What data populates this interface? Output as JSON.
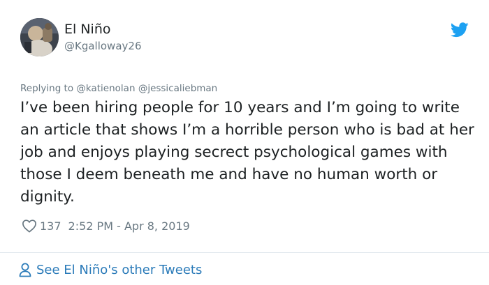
{
  "author": {
    "display_name": "El Niño",
    "handle": "@Kgalloway26"
  },
  "replying": {
    "prefix": "Replying to",
    "mentions": [
      "@katienolan",
      "@jessicaliebman"
    ]
  },
  "tweet": {
    "text": "I’ve been hiring people for 10 years and I’m going to write an article that shows I’m a horrible person who is bad at her job and enjoys playing secrect psychological games with those I deem beneath me and have no human worth or dignity.",
    "like_count": "137",
    "timestamp": "2:52 PM - Apr 8, 2019"
  },
  "footer": {
    "see_more_label": "See El Niño's other Tweets"
  },
  "icons": {
    "brand": "twitter-bird-icon",
    "like": "heart-icon",
    "profile": "person-icon"
  },
  "colors": {
    "text": "#1c2022",
    "muted": "#697882",
    "link": "#2b7bb9",
    "twitter_blue": "#1da1f2",
    "divider": "#e1e8ed"
  }
}
